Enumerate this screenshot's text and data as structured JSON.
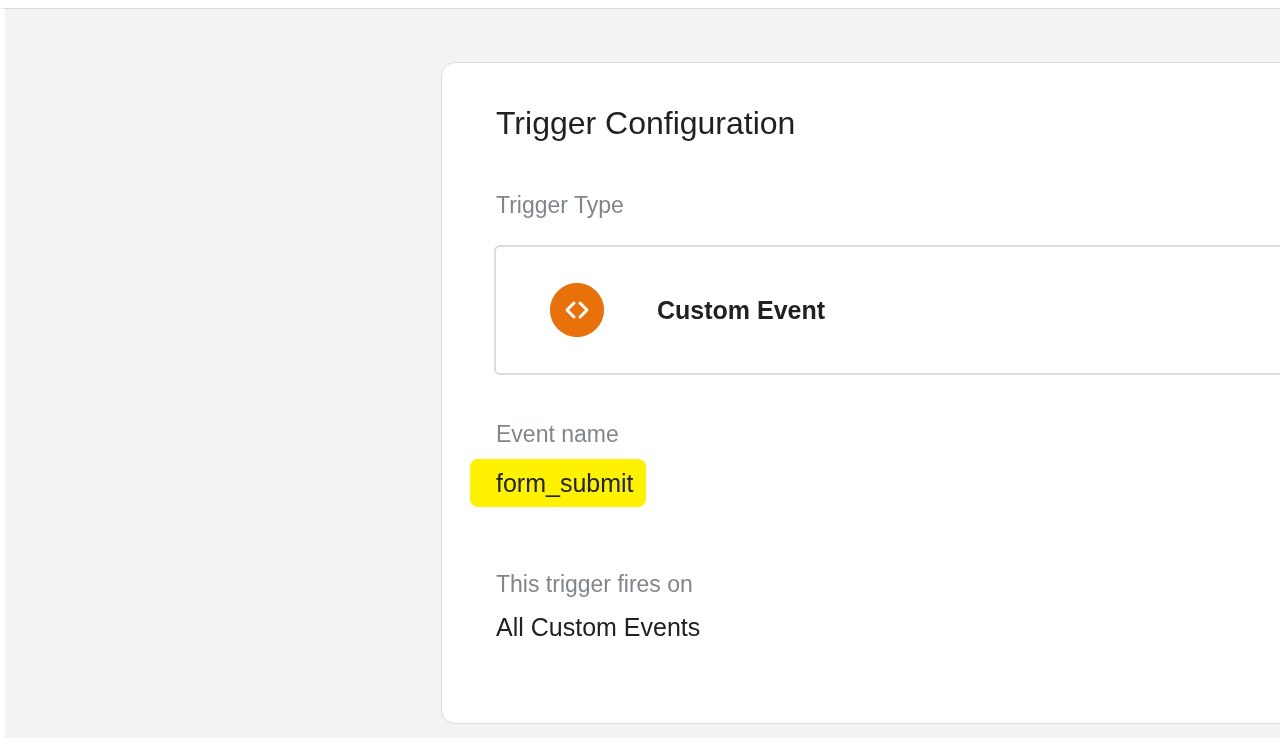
{
  "card": {
    "title": "Trigger Configuration",
    "trigger_type": {
      "label": "Trigger Type",
      "value": "Custom Event"
    },
    "event_name": {
      "label": "Event name",
      "value": "form_submit",
      "highlighted": true
    },
    "fires_on": {
      "label": "This trigger fires on",
      "value": "All Custom Events"
    }
  }
}
